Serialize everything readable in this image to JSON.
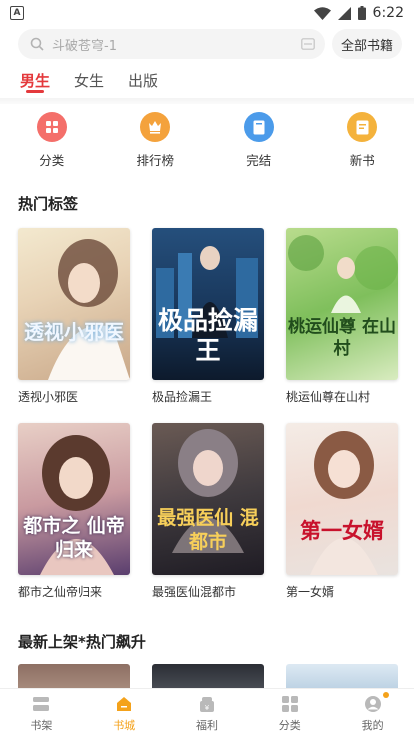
{
  "status_bar": {
    "time": "6:22",
    "app_badge": "A"
  },
  "search": {
    "placeholder": "斗破苍穹-1",
    "all_books_label": "全部书籍"
  },
  "tabs": [
    {
      "label": "男生",
      "active": true
    },
    {
      "label": "女生",
      "active": false
    },
    {
      "label": "出版",
      "active": false
    }
  ],
  "categories": [
    {
      "label": "分类",
      "icon": "grid-icon",
      "color": "#f46f6a"
    },
    {
      "label": "排行榜",
      "icon": "ranking-icon",
      "color": "#f4a23c"
    },
    {
      "label": "完结",
      "icon": "book-complete-icon",
      "color": "#4b9bea"
    },
    {
      "label": "新书",
      "icon": "new-book-icon",
      "color": "#f4b23c"
    }
  ],
  "hot_tags": {
    "title": "热门标签",
    "books": [
      {
        "title": "透视小邪医",
        "cover_text": "透视小邪医"
      },
      {
        "title": "极品捡漏王",
        "cover_text": "极品捡漏王"
      },
      {
        "title": "桃运仙尊在山村",
        "cover_text": "桃运仙尊 在山村"
      },
      {
        "title": "都市之仙帝归来",
        "cover_text": "都市之 仙帝归来"
      },
      {
        "title": "最强医仙混都市",
        "cover_text": "最强医仙 混都市"
      },
      {
        "title": "第一女婿",
        "cover_text": "第一女婿"
      }
    ]
  },
  "new_hot": {
    "title": "最新上架*热门飙升"
  },
  "bottom_nav": [
    {
      "label": "书架",
      "icon": "bookshelf-icon",
      "active": false
    },
    {
      "label": "书城",
      "icon": "bookstore-icon",
      "active": true
    },
    {
      "label": "福利",
      "icon": "gift-icon",
      "active": false
    },
    {
      "label": "分类",
      "icon": "category-icon",
      "active": false
    },
    {
      "label": "我的",
      "icon": "profile-icon",
      "active": false
    }
  ],
  "colors": {
    "accent_red": "#e4393c",
    "active_orange": "#f4a21b"
  }
}
